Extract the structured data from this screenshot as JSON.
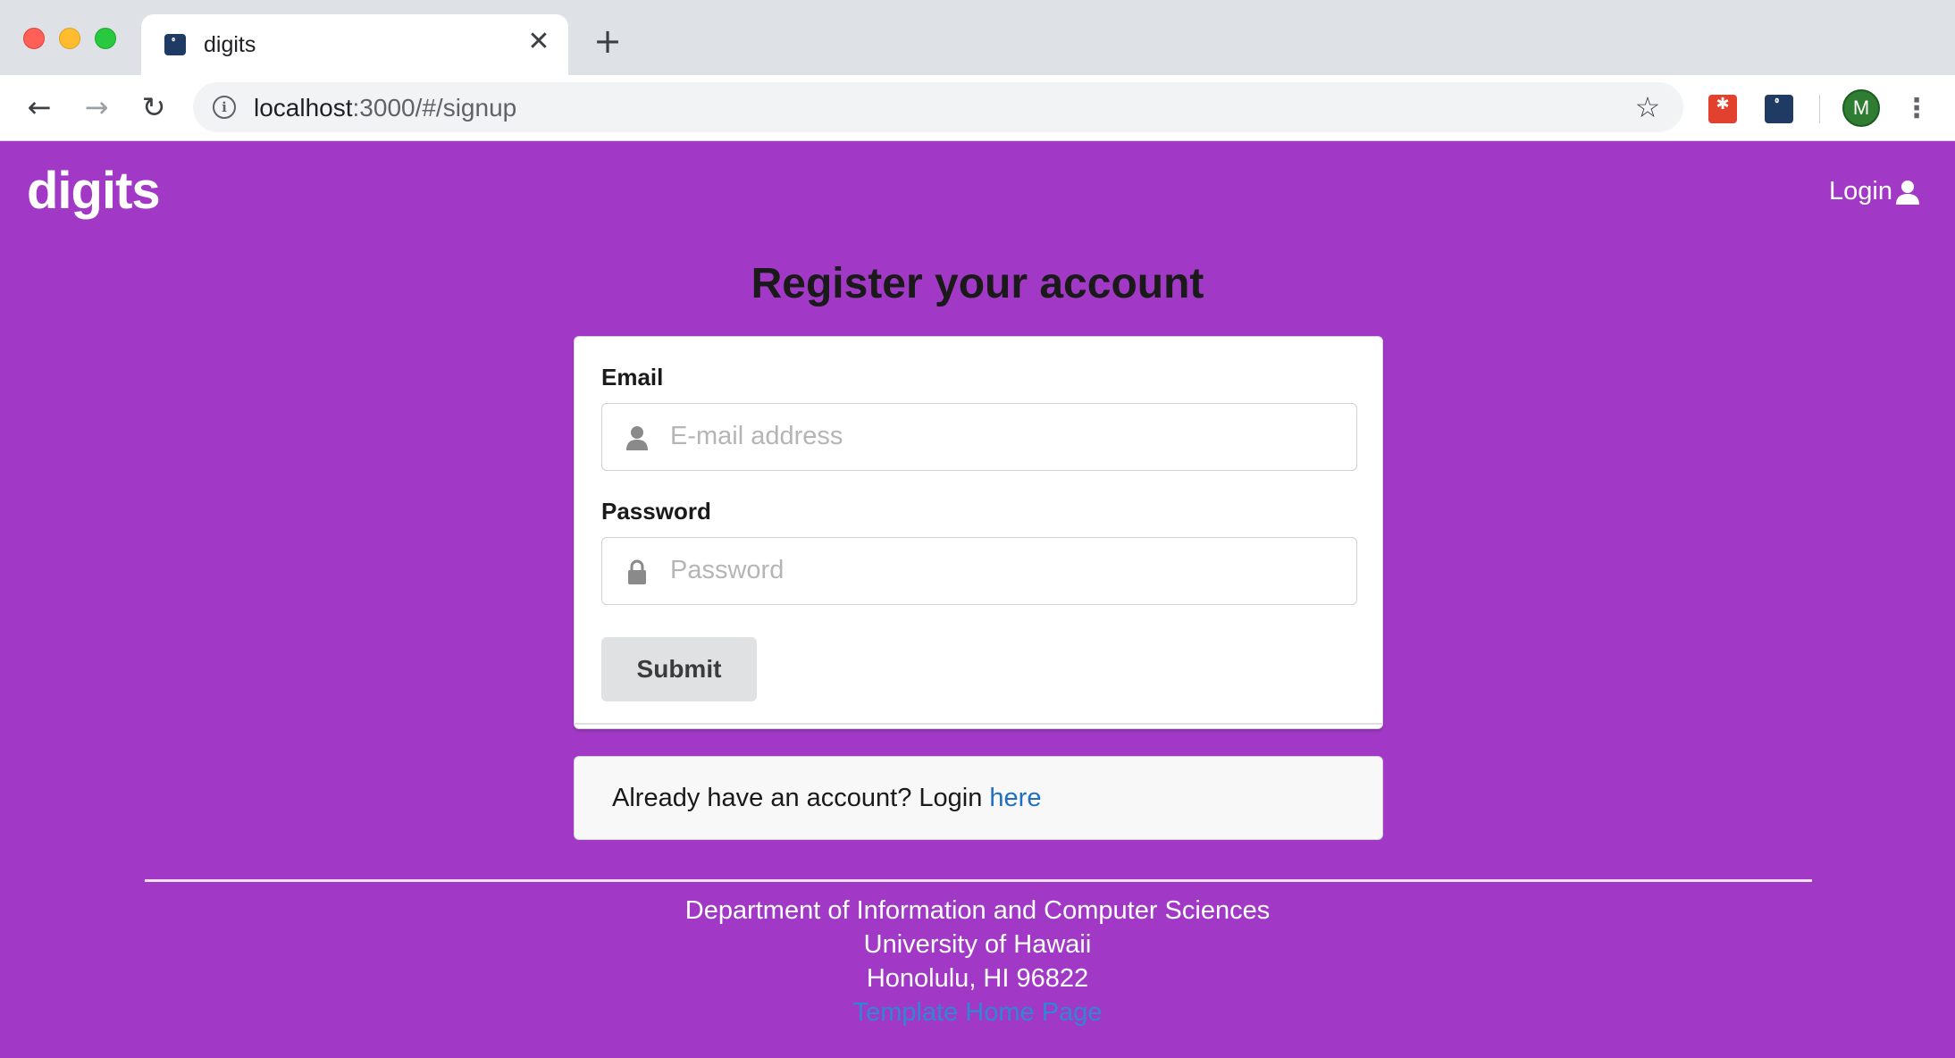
{
  "browser": {
    "tab_title": "digits",
    "tab_close_glyph": "✕",
    "new_tab_glyph": "+",
    "url_host": "localhost",
    "url_rest": ":3000/#/signup",
    "back_glyph": "←",
    "forward_glyph": "→",
    "reload_glyph": "↻",
    "info_glyph": "i",
    "star_glyph": "☆",
    "profile_initial": "M",
    "menu_glyph": "⋮",
    "icons": [
      "back-arrow-icon",
      "forward-arrow-icon",
      "reload-icon",
      "info-icon",
      "star-icon",
      "extension-icon",
      "menu-icon"
    ]
  },
  "navbar": {
    "brand": "digits",
    "login_label": "Login"
  },
  "main": {
    "heading": "Register your account",
    "email": {
      "label": "Email",
      "placeholder": "E-mail address"
    },
    "password": {
      "label": "Password",
      "placeholder": "Password"
    },
    "submit_label": "Submit",
    "login_prompt": "Already have an account? Login ",
    "login_link": "here"
  },
  "footer": {
    "line1": "Department of Information and Computer Sciences",
    "line2": "University of Hawaii",
    "line3": "Honolulu, HI 96822",
    "link": "Template Home Page"
  },
  "colors": {
    "page_background": "#a239c6",
    "link": "#1e70bf",
    "button": "#e0e1e2"
  }
}
